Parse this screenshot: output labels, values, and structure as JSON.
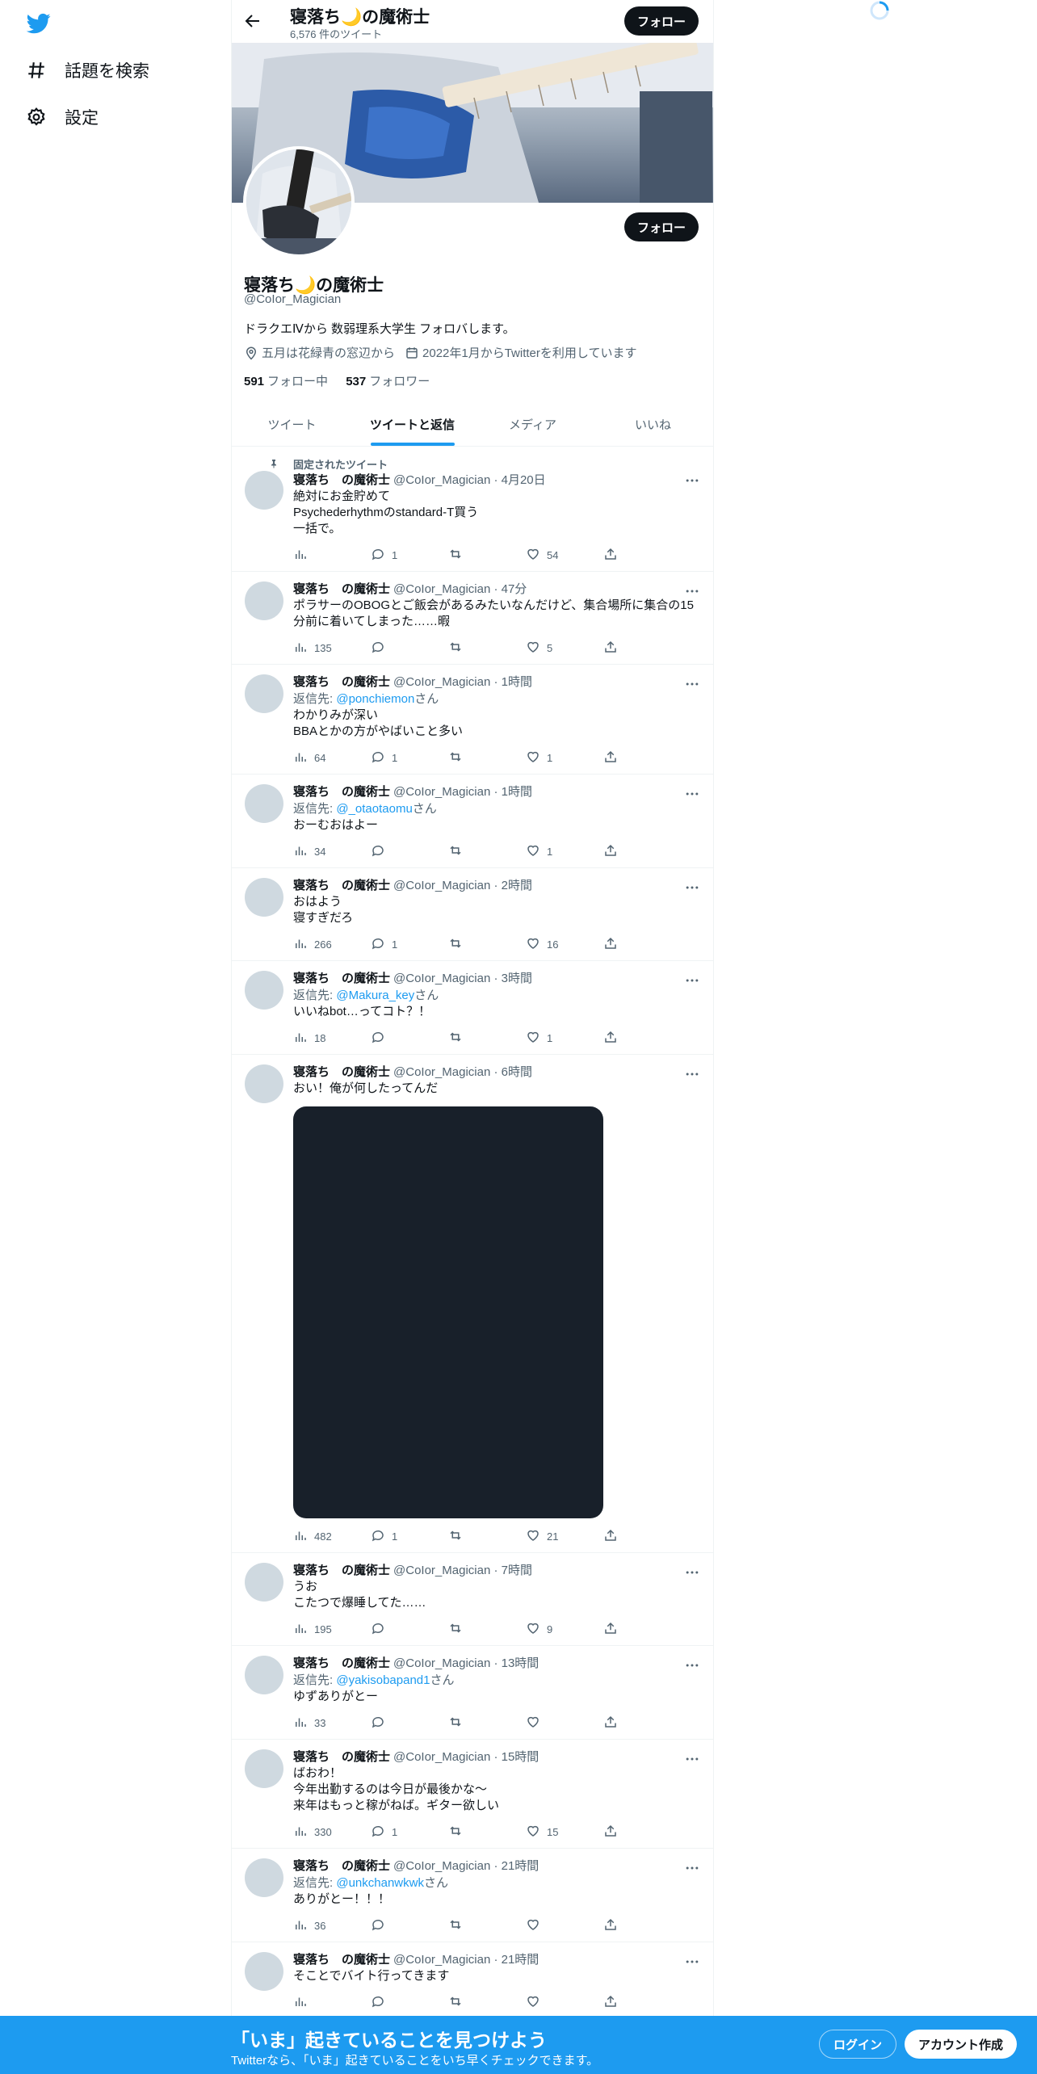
{
  "nav": {
    "logo_icon": "twitter-bird-icon",
    "items": [
      {
        "label": "話題を検索",
        "icon": "hashtag-icon"
      },
      {
        "label": "設定",
        "icon": "gear-icon"
      }
    ]
  },
  "header": {
    "name": "寝落ち🌙の魔術士",
    "tweet_count": "6,576 件のツイート",
    "follow_label": "フォロー"
  },
  "profile": {
    "name": "寝落ち🌙の魔術士",
    "handle": "@CoIor_Magician",
    "bio": "ドラクエⅣから 数弱理系大学生 フォロバします。",
    "location": "五月は花緑青の窓辺から",
    "joined": "2022年1月からTwitterを利用しています",
    "following_count": "591",
    "following_label": "フォロー中",
    "followers_count": "537",
    "followers_label": "フォロワー",
    "follow_label": "フォロー"
  },
  "tabs": [
    {
      "label": "ツイート",
      "active": false
    },
    {
      "label": "ツイートと返信",
      "active": true
    },
    {
      "label": "メディア",
      "active": false
    },
    {
      "label": "いいね",
      "active": false
    }
  ],
  "pinned_label": "固定されたツイート",
  "tweets": [
    {
      "name": "寝落ち　の魔術士",
      "meta": "@CoIor_Magician · 4月20日",
      "text": "絶対にお金貯めて\nPsychederhythmのstandard-T買う\n一括で。",
      "views": "",
      "replies": "1",
      "likes": "54"
    },
    {
      "name": "寝落ち　の魔術士",
      "meta": "@CoIor_Magician · 47分",
      "text": "ポラサーのOBOGとご飯会があるみたいなんだけど、集合場所に集合の15分前に着いてしまった……暇",
      "views": "135",
      "replies": "",
      "likes": "5"
    },
    {
      "name": "寝落ち　の魔術士",
      "meta": "@CoIor_Magician · 1時間",
      "reply_prefix": "返信先: ",
      "reply_to": "@ponchiemon",
      "reply_suffix": "さん",
      "text": "わかりみが深い\nBBAとかの方がやばいこと多い",
      "views": "64",
      "replies": "1",
      "likes": "1"
    },
    {
      "name": "寝落ち　の魔術士",
      "meta": "@CoIor_Magician · 1時間",
      "reply_prefix": "返信先: ",
      "reply_to": "@_otaotaomu",
      "reply_suffix": "さん",
      "text": "おーむおはよー",
      "views": "34",
      "replies": "",
      "likes": "1"
    },
    {
      "name": "寝落ち　の魔術士",
      "meta": "@CoIor_Magician · 2時間",
      "text": "おはよう\n寝すぎだろ",
      "views": "266",
      "replies": "1",
      "likes": "16"
    },
    {
      "name": "寝落ち　の魔術士",
      "meta": "@CoIor_Magician · 3時間",
      "reply_prefix": "返信先: ",
      "reply_to": "@Makura_key",
      "reply_suffix": "さん",
      "text": "いいねbot…ってコト？！",
      "views": "18",
      "replies": "",
      "likes": "1"
    },
    {
      "name": "寝落ち　の魔術士",
      "meta": "@CoIor_Magician · 6時間",
      "text": "おい！俺が何したってんだ",
      "media": true,
      "views": "482",
      "replies": "1",
      "likes": "21"
    },
    {
      "name": "寝落ち　の魔術士",
      "meta": "@CoIor_Magician · 7時間",
      "text": "うお\nこたつで爆睡してた……",
      "views": "195",
      "replies": "",
      "likes": "9"
    },
    {
      "name": "寝落ち　の魔術士",
      "meta": "@CoIor_Magician · 13時間",
      "reply_prefix": "返信先: ",
      "reply_to": "@yakisobapand1",
      "reply_suffix": "さん",
      "text": "ゆずありがとー",
      "views": "33",
      "replies": "",
      "likes": ""
    },
    {
      "name": "寝落ち　の魔術士",
      "meta": "@CoIor_Magician · 15時間",
      "text": "ばおわ！\n今年出勤するのは今日が最後かな〜\n来年はもっと稼がねば。ギター欲しい",
      "views": "330",
      "replies": "1",
      "likes": "15"
    },
    {
      "name": "寝落ち　の魔術士",
      "meta": "@CoIor_Magician · 21時間",
      "reply_prefix": "返信先: ",
      "reply_to": "@unkchanwkwk",
      "reply_suffix": "さん",
      "text": "ありがとー！！！",
      "views": "36",
      "replies": "",
      "likes": ""
    },
    {
      "name": "寝落ち　の魔術士",
      "meta": "@CoIor_Magician · 21時間",
      "text": "そことでバイト行ってきます",
      "views": "",
      "replies": "",
      "likes": ""
    }
  ],
  "bottom_banner": {
    "title": "「いま」起きていることを見つけよう",
    "subtitle": "Twitterなら、「いま」起きていることをいち早くチェックできます。",
    "login_label": "ログイン",
    "signup_label": "アカウント作成"
  },
  "colors": {
    "accent": "#1d9bf0",
    "text": "#0f1419",
    "secondary": "#536471"
  }
}
